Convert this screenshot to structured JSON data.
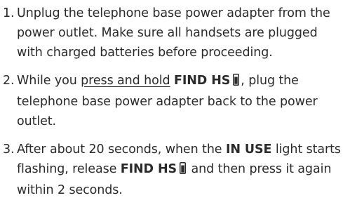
{
  "steps": [
    {
      "number": "1.",
      "text": "Unplug the telephone base power adapter from the power outlet. Make sure all handsets are plugged with charged batteries before proceeding."
    },
    {
      "number": "2.",
      "pre": "While you ",
      "underline": "press and hold",
      "space": " ",
      "key": "FIND HS",
      "icon": "handset-icon",
      "post": ", plug the telephone base power adapter back to the power outlet."
    },
    {
      "number": "3.",
      "pre": "After about 20 seconds, when the ",
      "key1": "IN USE",
      "mid": " light starts flashing, release ",
      "key2": "FIND HS",
      "icon": "handset-icon",
      "post": " and then press it again within 2 seconds."
    }
  ]
}
